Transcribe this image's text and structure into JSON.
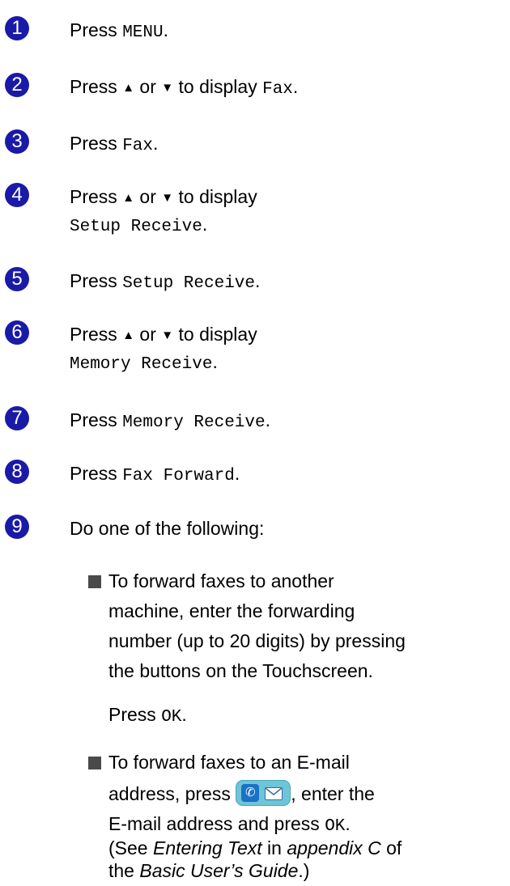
{
  "steps": [
    {
      "num": "1",
      "pre": "Press ",
      "code": "MENU",
      "post": "."
    },
    {
      "num": "2",
      "pre": "Press ",
      "up": "▲",
      "or": " or ",
      "down": "▼",
      "mid": " to display ",
      "code": "Fax",
      "post": "."
    },
    {
      "num": "3",
      "pre": "Press ",
      "code": "Fax",
      "post": "."
    },
    {
      "num": "4",
      "pre": "Press ",
      "up": "▲",
      "or": " or ",
      "down": "▼",
      "mid": " to display",
      "code": "Setup Receive",
      "post": "."
    },
    {
      "num": "5",
      "pre": "Press ",
      "code": "Setup Receive",
      "post": "."
    },
    {
      "num": "6",
      "pre": "Press ",
      "up": "▲",
      "or": " or ",
      "down": "▼",
      "mid": " to display",
      "code": "Memory Receive",
      "post": "."
    },
    {
      "num": "7",
      "pre": "Press ",
      "code": "Memory Receive",
      "post": "."
    },
    {
      "num": "8",
      "pre": "Press ",
      "code": "Fax Forward",
      "post": "."
    },
    {
      "num": "9",
      "text": "Do one of the following:"
    }
  ],
  "options": {
    "machine": {
      "lines": [
        "To forward faxes to another",
        "machine, enter the forwarding",
        "number (up to 20 digits) by pressing",
        "the buttons on the Touchscreen."
      ],
      "press": "Press ",
      "ok": "OK",
      "dot": "."
    },
    "email": {
      "line1": "To forward faxes to an E-mail",
      "line2_pre": "address, press ",
      "line2_post": ", enter the",
      "line3_pre": "E-mail address and press ",
      "ok": "OK",
      "dot": ".",
      "line4_a": "(See ",
      "line4_b": "Entering Text",
      "line4_c": " in ",
      "line4_d": "appendix C",
      "line4_e": " of",
      "line5_a": "the ",
      "line5_b": "Basic User’s Guide",
      "line5_c": ".)"
    }
  },
  "icons": {
    "fax_email_button": "fax-email-button-icon",
    "bullet": "square-bullet"
  },
  "colors": {
    "step_circle": "#1a1aa8",
    "button_bg": "#6cc6d8"
  }
}
